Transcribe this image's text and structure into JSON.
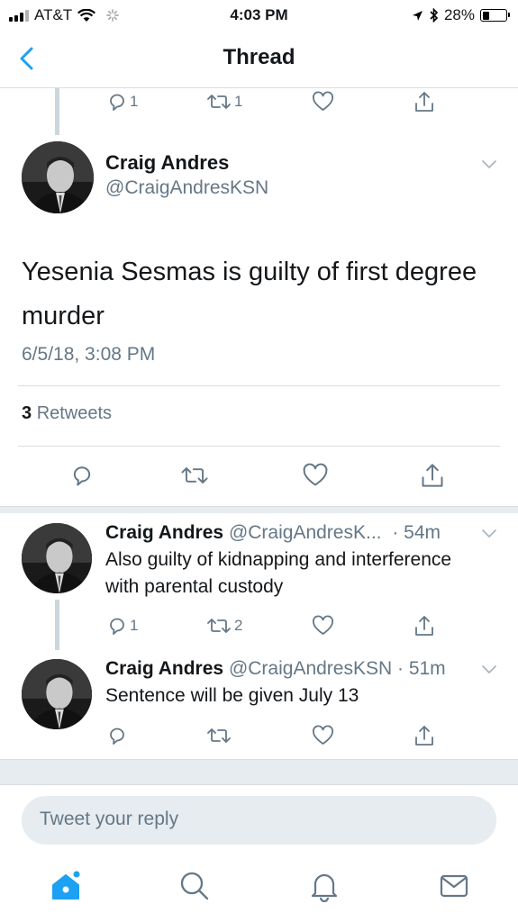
{
  "status_bar": {
    "carrier": "AT&T",
    "time": "4:03 PM",
    "battery": "28%",
    "battery_level": 0.28
  },
  "nav": {
    "title": "Thread",
    "back_icon": "chevron-left-icon"
  },
  "previous_tweet_actions": {
    "reply_count": "1",
    "retweet_count": "1"
  },
  "main_tweet": {
    "name": "Craig Andres",
    "handle": "@CraigAndresKSN",
    "text": "Yesenia Sesmas is guilty of first degree murder",
    "timestamp": "6/5/18, 3:08 PM",
    "retweet_count": "3",
    "retweet_label": "Retweets"
  },
  "replies": [
    {
      "name": "Craig Andres",
      "handle": "@CraigAndresK...",
      "time": "· 54m",
      "text": "Also guilty of kidnapping and interference with parental custody",
      "reply_count": "1",
      "retweet_count": "2"
    },
    {
      "name": "Craig Andres",
      "handle": "@CraigAndresKSN",
      "time": "· 51m",
      "text": "Sentence will be given July 13",
      "reply_count": "",
      "retweet_count": ""
    }
  ],
  "compose": {
    "placeholder": "Tweet your reply"
  },
  "tab_bar": {
    "items": [
      "home-icon",
      "search-icon",
      "notifications-icon",
      "messages-icon"
    ],
    "accent": "#1da1f2"
  },
  "colors": {
    "accent": "#1da1f2",
    "muted": "#657786",
    "divider": "#d8dde1"
  }
}
